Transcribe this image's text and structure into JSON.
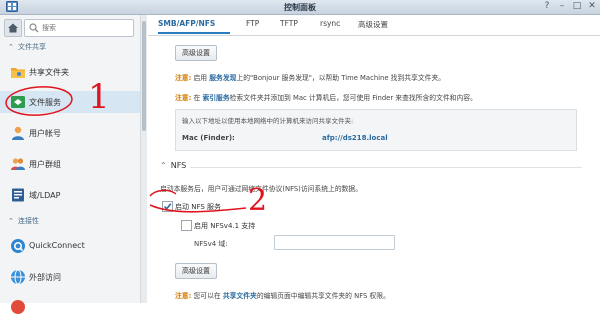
{
  "window": {
    "title": "控制面板",
    "controls": [
      "?",
      "–",
      "□",
      "✕"
    ]
  },
  "sidebar": {
    "search_placeholder": "搜索",
    "sections": [
      {
        "label": "文件共享"
      },
      {
        "label": "连接性"
      }
    ],
    "items": [
      {
        "label": "共享文件夹",
        "icon": "shared-folder-icon"
      },
      {
        "label": "文件服务",
        "icon": "file-services-icon",
        "active": true
      },
      {
        "label": "用户帐号",
        "icon": "user-icon"
      },
      {
        "label": "用户群组",
        "icon": "group-icon"
      },
      {
        "label": "域/LDAP",
        "icon": "domain-ldap-icon"
      },
      {
        "label": "QuickConnect",
        "icon": "quickconnect-icon"
      },
      {
        "label": "外部访问",
        "icon": "external-access-icon"
      }
    ]
  },
  "tabs": [
    "SMB/AFP/NFS",
    "FTP",
    "TFTP",
    "rsync",
    "高级设置"
  ],
  "afp": {
    "advanced_button": "高级设置",
    "note1": {
      "prefix": "注意:",
      "a": "启用",
      "link": "服务发现",
      "b": "上的\"Bonjour 服务发现\"，以帮助 Time Machine 找到共享文件夹。"
    },
    "note2": {
      "prefix": "注意:",
      "a": "在",
      "link": "索引服务",
      "b": "检索文件夹并添加到 Mac 计算机后，您可使用 Finder 来查找所含的文件和内容。"
    },
    "info_text": "输入以下地址以使用本地网络中的计算机来访问共享文件夹:",
    "finder_label": "Mac (Finder):",
    "finder_value": "afp://ds218.local"
  },
  "nfs": {
    "heading": "NFS",
    "description": "启动本服务后，用户可通过网络文件协议(NFS)访问系统上的数据。",
    "enable_nfs": {
      "label": "启动 NFS 服务",
      "checked": true
    },
    "enable_nfsv41": {
      "label": "启用 NFSv4.1 支持",
      "checked": false
    },
    "nfsv4_domain_label": "NFSv4 域:",
    "nfsv4_domain_value": "",
    "advanced_button": "高级设置",
    "note": {
      "prefix": "注意:",
      "a": "您可以在",
      "link": "共享文件夹",
      "b": "的编辑页面中编辑共享文件夹的 NFS 权限。"
    }
  },
  "annotations": {
    "step1": "1",
    "step2": "2",
    "color": "#e0141e"
  }
}
